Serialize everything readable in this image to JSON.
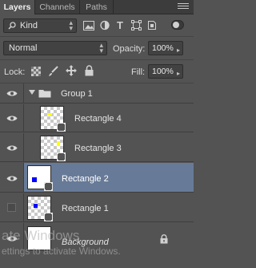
{
  "tabs": [
    {
      "label": "Layers",
      "active": true
    },
    {
      "label": "Channels",
      "active": false
    },
    {
      "label": "Paths",
      "active": false
    }
  ],
  "filter": {
    "value": "Kind"
  },
  "blend": {
    "mode": "Normal",
    "opacity_label": "Opacity:",
    "opacity_value": "100%"
  },
  "lock": {
    "label": "Lock:",
    "fill_label": "Fill:",
    "fill_value": "100%"
  },
  "layers": {
    "group": {
      "name": "Group 1",
      "visible": true,
      "expanded": true
    },
    "items": [
      {
        "name": "Rectangle 4",
        "visible": true,
        "selected": false,
        "swatch_color": "#ffff00"
      },
      {
        "name": "Rectangle 3",
        "visible": true,
        "selected": false,
        "swatch_color": "#ffff00"
      },
      {
        "name": "Rectangle 2",
        "visible": true,
        "selected": true,
        "swatch_color": "#0000ff"
      },
      {
        "name": "Rectangle 1",
        "visible": false,
        "selected": false,
        "swatch_color": "#0000ff"
      }
    ],
    "background": {
      "name": "Background",
      "visible": true,
      "locked": true
    }
  },
  "watermark": {
    "line1": "ate Windows",
    "line2": "ettings to activate Windows."
  },
  "colors": {
    "panel": "#535353",
    "selected_row": "#677a98",
    "tab_bar": "#3c3c3c"
  }
}
